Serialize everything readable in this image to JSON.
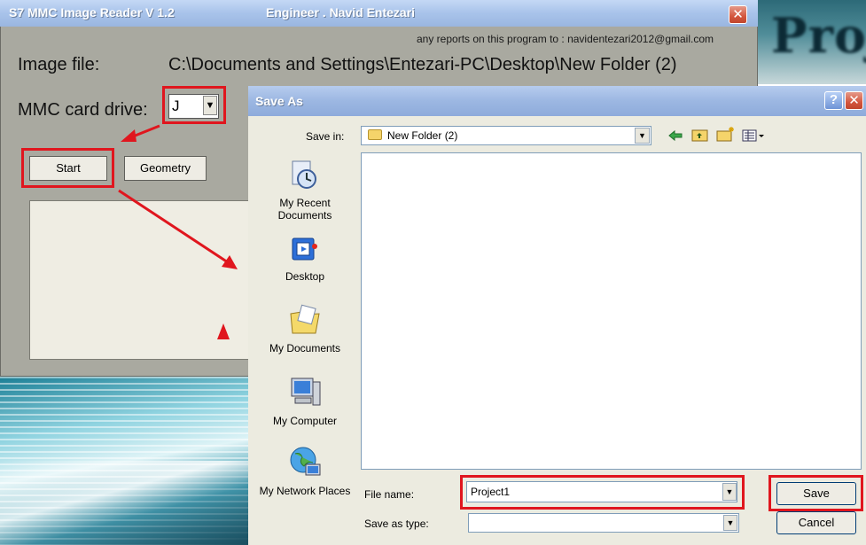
{
  "app": {
    "title": "S7 MMC Image Reader V 1.2",
    "engineer": "Engineer . Navid Entezari",
    "reports": "any reports on this program to : navidentezari2012@gmail.com",
    "image_file_label": "Image file:",
    "image_file_value": "C:\\Documents and Settings\\Entezari-PC\\Desktop\\New Folder (2)",
    "mmc_label": "MMC card drive:",
    "mmc_value": "J",
    "start_label": "Start",
    "geometry_label": "Geometry",
    "close_glyph": "✕"
  },
  "background": {
    "partial_text": "Proj"
  },
  "dialog": {
    "title": "Save As",
    "help_glyph": "?",
    "close_glyph": "✕",
    "save_in_label": "Save in:",
    "save_in_value": "New Folder (2)",
    "toolbar_icons": [
      "back-arrow-icon",
      "up-folder-icon",
      "new-folder-icon",
      "view-menu-icon"
    ],
    "places": [
      {
        "label": "My Recent Documents",
        "icon": "recent-documents-icon"
      },
      {
        "label": "Desktop",
        "icon": "desktop-icon"
      },
      {
        "label": "My Documents",
        "icon": "my-documents-icon"
      },
      {
        "label": "My Computer",
        "icon": "my-computer-icon"
      },
      {
        "label": "My Network Places",
        "icon": "network-places-icon"
      }
    ],
    "file_name_label": "File name:",
    "file_name_value": "Project1",
    "save_type_label": "Save as type:",
    "save_type_value": "",
    "save_label": "Save",
    "cancel_label": "Cancel"
  },
  "colors": {
    "highlight": "#e0161e",
    "titlebar": "#a8c3ea"
  }
}
